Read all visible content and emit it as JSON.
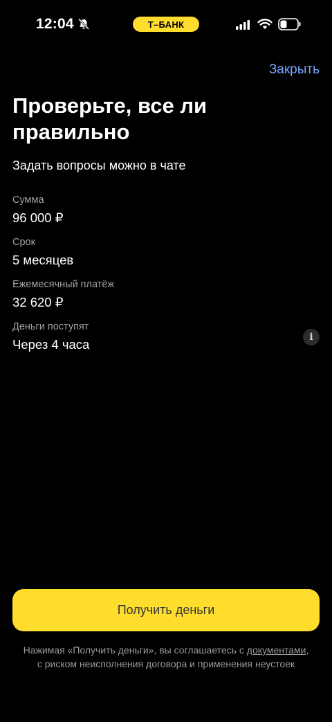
{
  "status_bar": {
    "time": "12:04",
    "carrier": "Т–БАНК",
    "icons": [
      "bell-slash-icon",
      "signal-icon",
      "wifi-icon",
      "battery-icon"
    ],
    "accent_color": "#ffdd2d"
  },
  "header": {
    "close_label": "Закрыть",
    "title": "Проверьте, все ли правильно",
    "subtitle": "Задать вопросы можно в чате"
  },
  "details": [
    {
      "label": "Сумма",
      "value": "96 000 ₽"
    },
    {
      "label": "Срок",
      "value": "5 месяцев"
    },
    {
      "label": "Ежемесячный платёж",
      "value": "32 620 ₽"
    },
    {
      "label": "Деньги поступят",
      "value": "Через 4 часа"
    }
  ],
  "info_icon": "info-icon",
  "action": {
    "primary_label": "Получить деньги",
    "button_color": "#ffdd2d"
  },
  "disclaimer": {
    "prefix": "Нажимая «Получить деньги», вы соглашаетесь с ",
    "link": "документами",
    "suffix": ", с риском неисполнения договора и применения неустоек"
  }
}
